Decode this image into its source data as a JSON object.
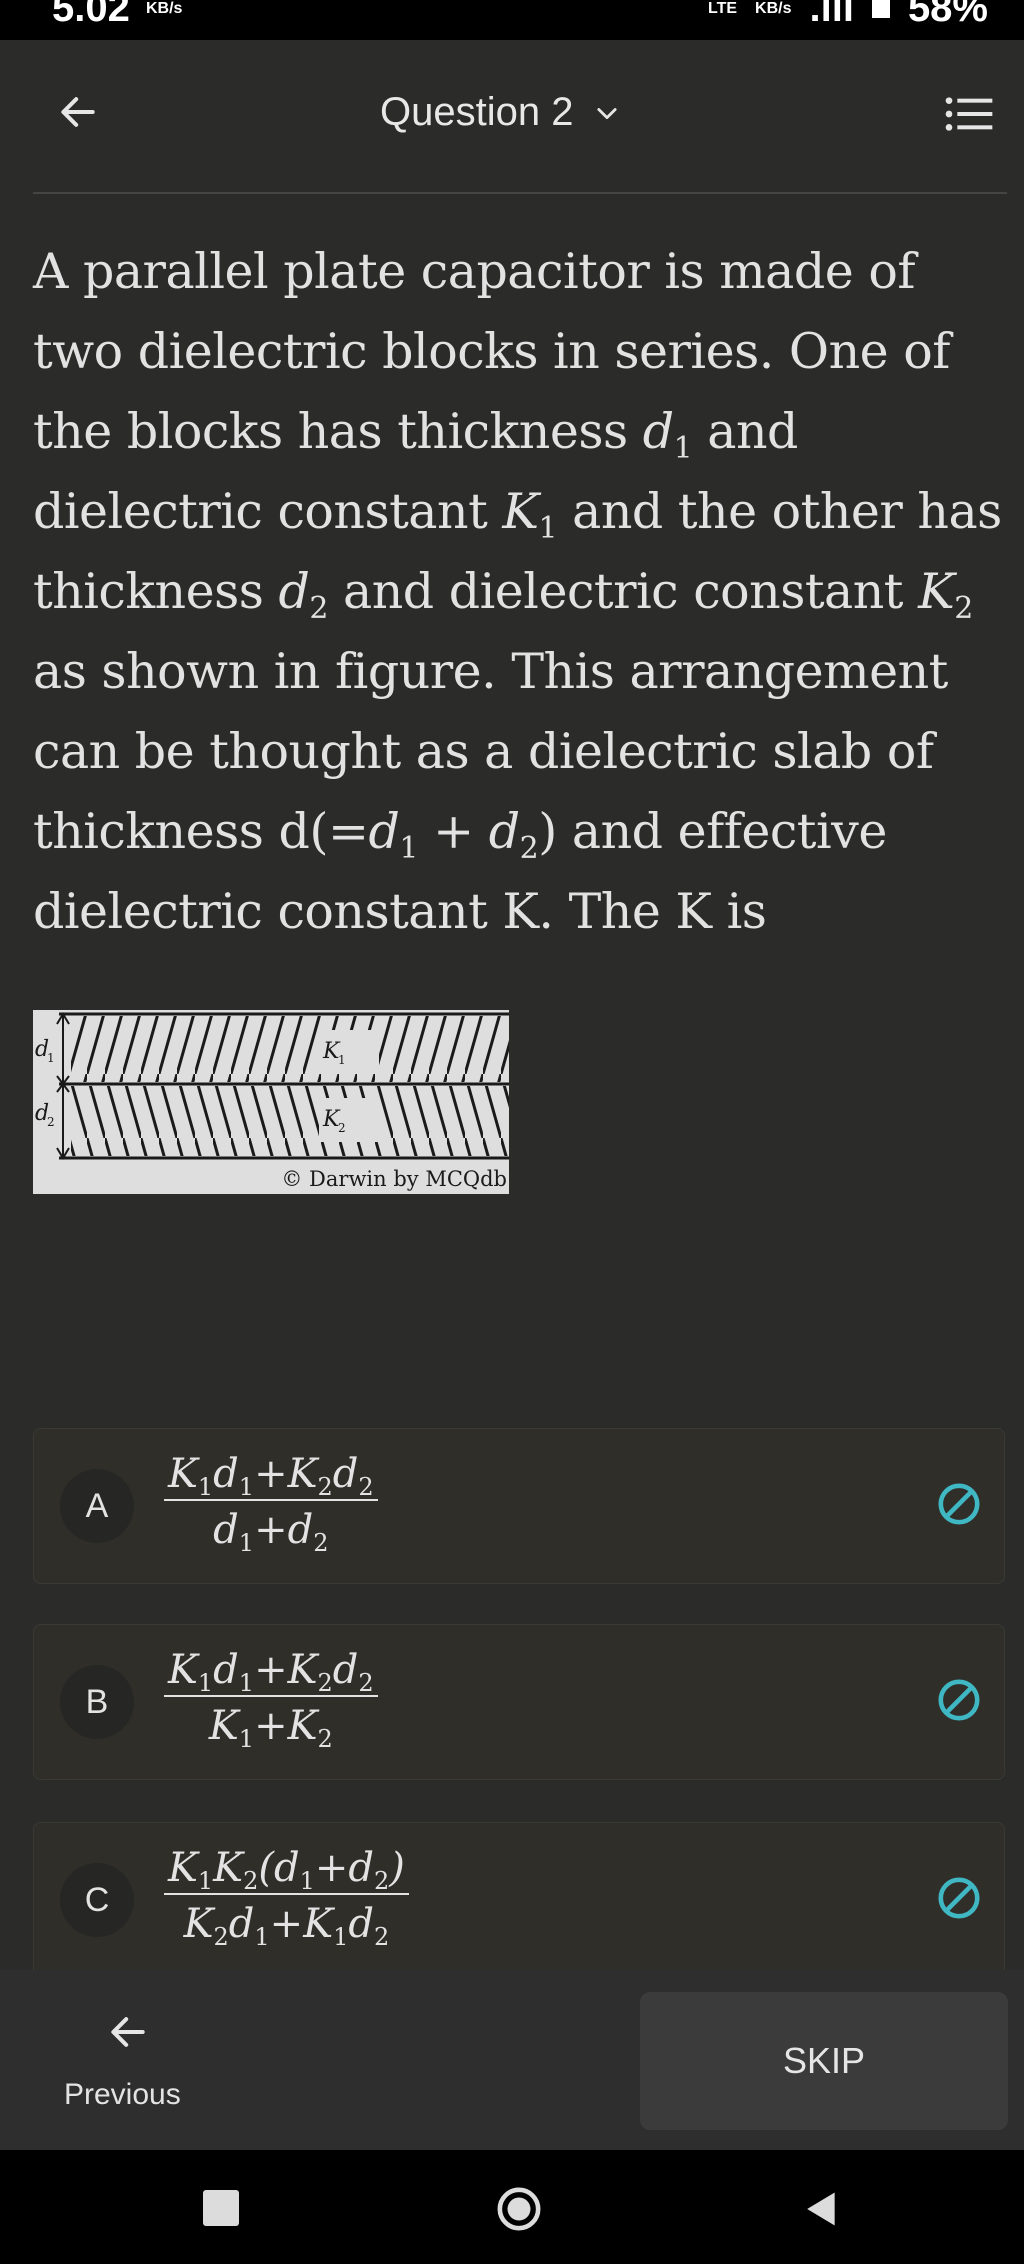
{
  "status_bar": {
    "speed_left": "5.02",
    "speed_left_unit": "KB/s",
    "network": "LTE",
    "speed_right_unit": "KB/s",
    "signal": ".ııl",
    "battery": "58%"
  },
  "header": {
    "title": "Question 2"
  },
  "question": {
    "text_parts": {
      "p1": "A parallel plate capacitor is made of two dielectric blocks in series. One of the blocks has thickness ",
      "d1_var": "d",
      "d1_sub": "1",
      "p2": " and dielectric constant ",
      "k1_var": "K",
      "k1_sub": "1",
      "p3": " and the other has thickness ",
      "d2_var": "d",
      "d2_sub": "2",
      "p4": " and dielectric constant ",
      "k2_var": "K",
      "k2_sub": "2",
      "p5": " as shown in figure. This arrangement can be thought as a dielectric slab of thickness d(=",
      "d1b_var": "d",
      "d1b_sub": "1",
      "plus": " + ",
      "d2b_var": "d",
      "d2b_sub": "2",
      "p6": ") and effective dielectric constant K. The K is"
    }
  },
  "figure": {
    "label_d1": "d",
    "label_d1_sub": "1",
    "label_d2": "d",
    "label_d2_sub": "2",
    "label_k1": "K",
    "label_k1_sub": "1",
    "label_k2": "K",
    "label_k2_sub": "2",
    "watermark": "© Darwin by MCQdb"
  },
  "options": [
    {
      "letter": "A",
      "numerator": {
        "a": "K",
        "a_sub": "1",
        "b": "d",
        "b_sub": "1",
        "op": "+",
        "c": "K",
        "c_sub": "2",
        "d": "d",
        "d_sub": "2"
      },
      "denominator": {
        "a": "d",
        "a_sub": "1",
        "op": "+",
        "b": "d",
        "b_sub": "2"
      }
    },
    {
      "letter": "B",
      "numerator": {
        "a": "K",
        "a_sub": "1",
        "b": "d",
        "b_sub": "1",
        "op": "+",
        "c": "K",
        "c_sub": "2",
        "d": "d",
        "d_sub": "2"
      },
      "denominator": {
        "a": "K",
        "a_sub": "1",
        "op": "+",
        "b": "K",
        "b_sub": "2"
      }
    },
    {
      "letter": "C",
      "numerator": {
        "a": "K",
        "a_sub": "1",
        "b": "K",
        "b_sub": "2",
        "open": "(",
        "c": "d",
        "c_sub": "1",
        "op": "+",
        "d": "d",
        "d_sub": "2",
        "close": ")"
      },
      "denominator": {
        "a": "K",
        "a_sub": "2",
        "b": "d",
        "b_sub": "1",
        "op": "+",
        "c": "K",
        "c_sub": "1",
        "d": "d",
        "d_sub": "2"
      }
    }
  ],
  "footer": {
    "previous_label": "Previous",
    "skip_label": "SKIP"
  },
  "colors": {
    "background": "#2b2b2a",
    "accent_icon": "#3fb8c4",
    "text": "#e6e6e6"
  },
  "icons": {
    "back": "arrow-left-icon",
    "dropdown": "chevron-down-icon",
    "menu": "list-icon",
    "not_attempted": "block-icon"
  }
}
